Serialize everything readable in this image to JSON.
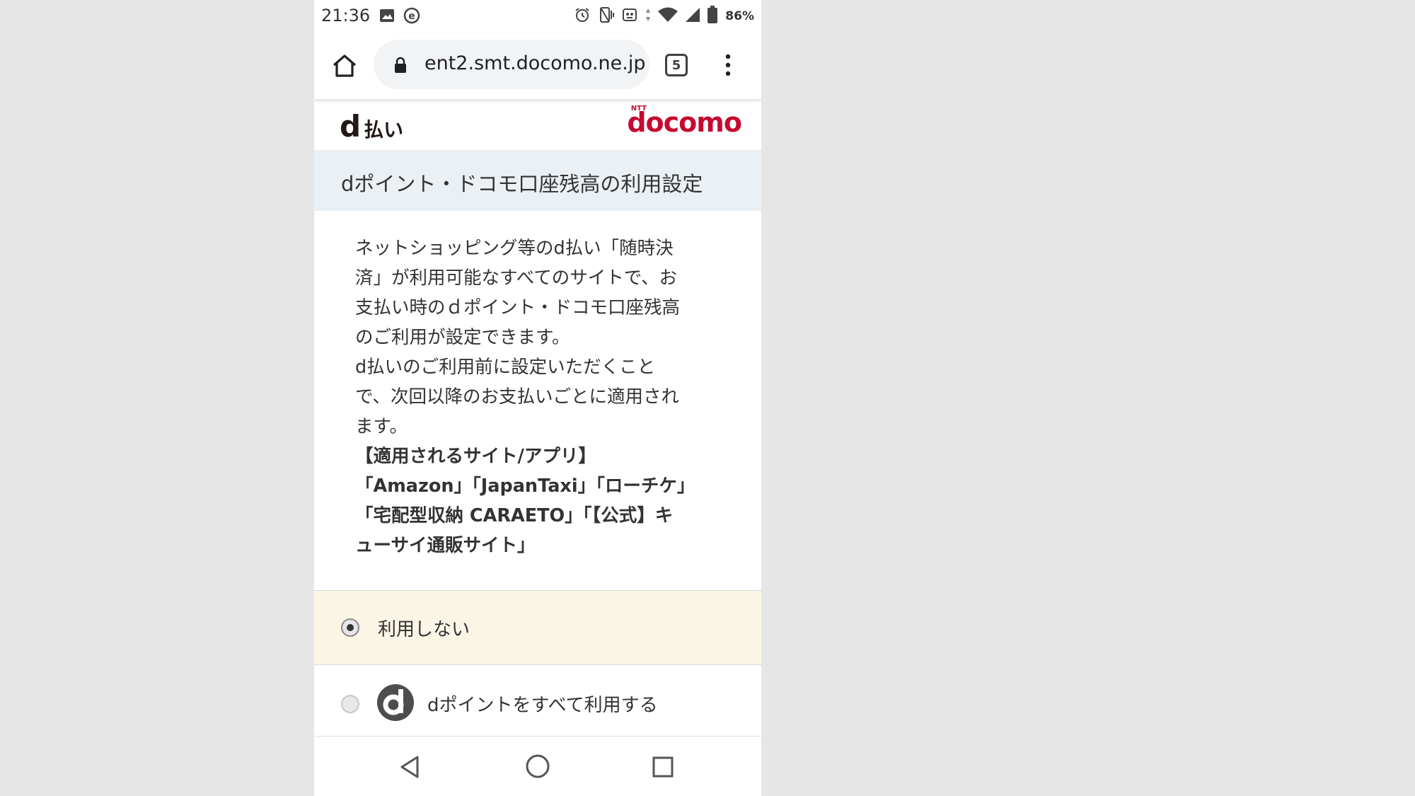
{
  "status_bar": {
    "time": "21:36",
    "left_icons": [
      "image-icon",
      "e-app-icon"
    ],
    "right_icons": [
      "alarm-icon",
      "vibrate-icon",
      "app-notification-icon",
      "wifi-icon",
      "signal-icon",
      "battery-icon"
    ],
    "battery": "86%"
  },
  "browser": {
    "url": "ent2.smt.docomo.ne.jp",
    "tab_count": "5"
  },
  "header": {
    "left_logo_d": "d",
    "left_logo_text": "払い",
    "right_logo_small": "NTT",
    "right_logo": "docomo",
    "brand_color": "#c40a32"
  },
  "title": "dポイント・ドコモ口座残高の利用設定",
  "description": {
    "lines": [
      "ネットショッピング等のd払い「随時決",
      "済」が利用可能なすべてのサイトで、お",
      "支払い時のｄポイント・ドコモ口座残高",
      "のご利用が設定できます。",
      "d払いのご利用前に設定いただくこと",
      "で、次回以降のお支払いごとに適用され",
      "ます。"
    ],
    "bold_lines": [
      "【適用されるサイト/アプリ】",
      "「Amazon」「JapanTaxi」「ローチケ」",
      "「宅配型収納 CARAETO」「【公式】キ",
      "ューサイ通販サイト」"
    ]
  },
  "options": {
    "none_label": "利用しない",
    "none_selected": true,
    "all_label": "dポイントをすべて利用する",
    "all_selected": false
  }
}
